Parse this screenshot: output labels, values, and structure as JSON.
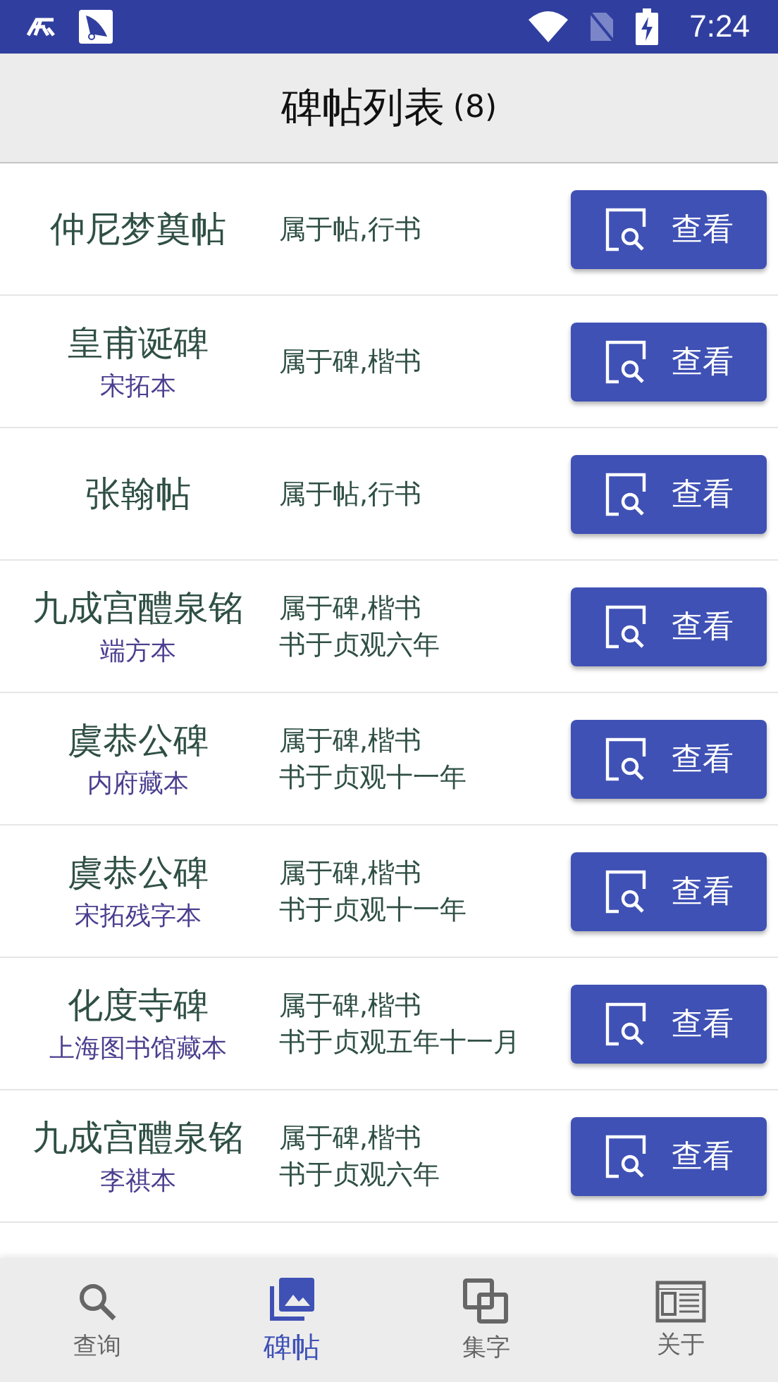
{
  "status_bar": {
    "time": "7:24"
  },
  "app_bar": {
    "title": "碑帖列表",
    "count": "(8)"
  },
  "rows": [
    {
      "name": "仲尼梦奠帖",
      "details": [
        "属于帖,行书"
      ],
      "button": "查看"
    },
    {
      "name": "皇甫诞碑",
      "edition": "宋拓本",
      "details": [
        "属于碑,楷书"
      ],
      "button": "查看"
    },
    {
      "name": "张翰帖",
      "details": [
        "属于帖,行书"
      ],
      "button": "查看"
    },
    {
      "name": "九成宫醴泉铭",
      "edition": "端方本",
      "details": [
        "属于碑,楷书",
        "书于贞观六年"
      ],
      "button": "查看"
    },
    {
      "name": "虞恭公碑",
      "edition": "内府藏本",
      "details": [
        "属于碑,楷书",
        "书于贞观十一年"
      ],
      "button": "查看"
    },
    {
      "name": "虞恭公碑",
      "edition": "宋拓残字本",
      "details": [
        "属于碑,楷书",
        "书于贞观十一年"
      ],
      "button": "查看"
    },
    {
      "name": "化度寺碑",
      "edition": "上海图书馆藏本",
      "details": [
        "属于碑,楷书",
        "书于贞观五年十一月"
      ],
      "button": "查看"
    },
    {
      "name": "九成宫醴泉铭",
      "edition": "李祺本",
      "details": [
        "属于碑,楷书",
        "书于贞观六年"
      ],
      "button": "查看"
    }
  ],
  "bottom_nav": [
    {
      "kind": "search",
      "label": "查询",
      "selected": false
    },
    {
      "kind": "gallery",
      "label": "碑帖",
      "selected": true
    },
    {
      "kind": "squares",
      "label": "集字",
      "selected": false
    },
    {
      "kind": "page",
      "label": "关于",
      "selected": false
    }
  ]
}
